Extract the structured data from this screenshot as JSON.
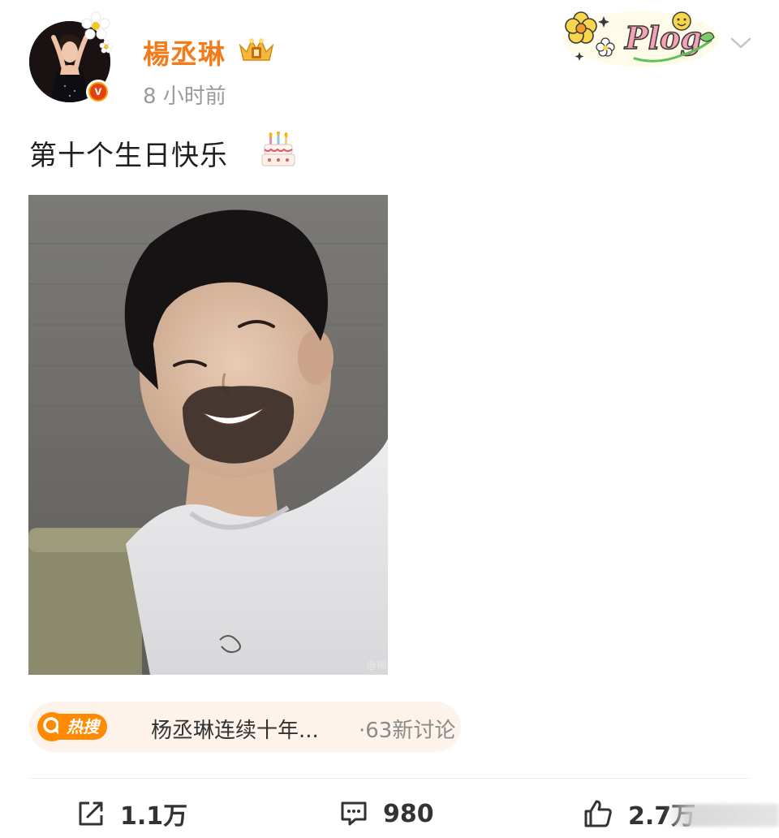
{
  "header": {
    "username": "楊丞琳",
    "post_time": "8 小时前",
    "sticker_text": "Plog"
  },
  "post": {
    "text": "第十个生日快乐",
    "watermark": "@楊"
  },
  "hot_search": {
    "logo_label": "热搜",
    "title": "杨丞琳连续十年...",
    "discussion_count": "·63新讨论"
  },
  "actions": {
    "repost_count": "1.1万",
    "comment_count": "980",
    "like_count": "2.7万"
  },
  "colors": {
    "username": "#f27c1a",
    "hot_accent": "#ff8a00",
    "time": "#9a9a9a"
  },
  "icons": [
    "verified-icon",
    "vip-crown-icon",
    "chevron-down-icon",
    "cake-emoji-icon",
    "repost-icon",
    "comment-icon",
    "like-icon"
  ]
}
